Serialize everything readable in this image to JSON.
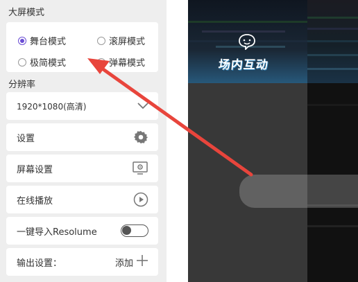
{
  "sections": {
    "screen_mode_title": "大屏模式",
    "resolution_title": "分辨率"
  },
  "screen_modes": [
    {
      "label": "舞台模式",
      "checked": true
    },
    {
      "label": "滚屏模式",
      "checked": false
    },
    {
      "label": "极简模式",
      "checked": false
    },
    {
      "label": "弹幕模式",
      "checked": false
    }
  ],
  "resolution": {
    "value": "1920*1080(高清)",
    "icon": "chevron-down-icon"
  },
  "rows": {
    "settings": {
      "label": "设置",
      "icon": "gear-icon"
    },
    "screen_settings": {
      "label": "屏幕设置",
      "icon": "monitor-settings-icon"
    },
    "online_play": {
      "label": "在线播放",
      "icon": "play-circle-icon"
    },
    "resolume": {
      "label": "一键导入Resolume",
      "toggle_on": false
    },
    "output": {
      "label": "输出设置：",
      "add_label": "添加",
      "icon": "plus-icon"
    }
  },
  "preview": {
    "logo_text": "场内互动",
    "logo_icon": "chat-bubble-face-icon"
  },
  "colors": {
    "accent": "#6a4cd4",
    "arrow": "#e8453c",
    "panel_bg": "#eeeeee",
    "preview_bg": "#1e1e1e"
  }
}
